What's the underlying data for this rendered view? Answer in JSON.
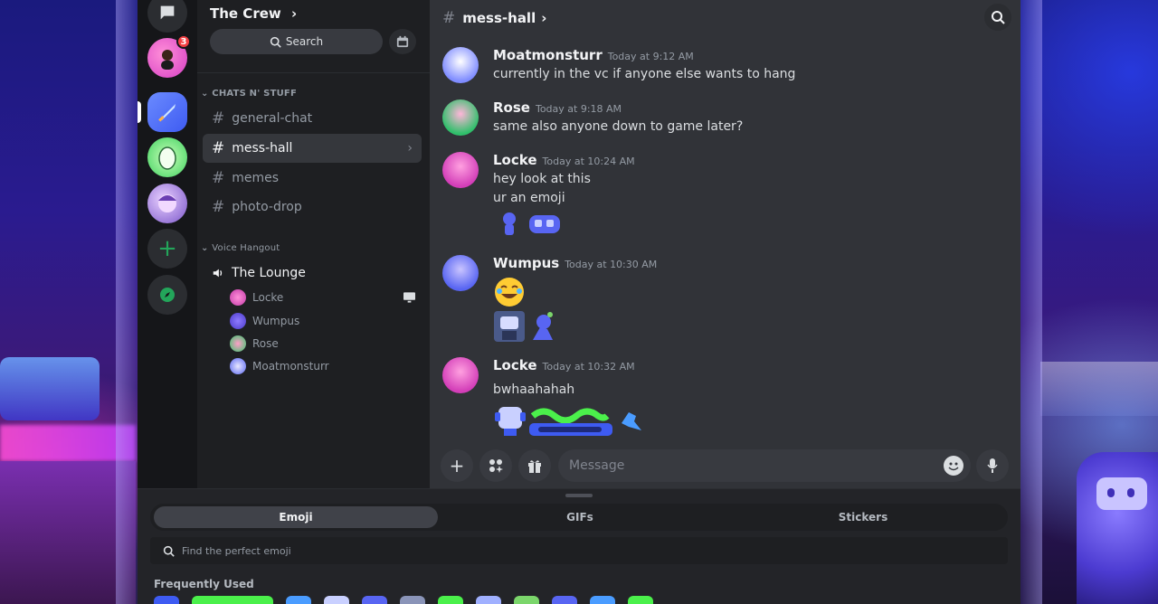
{
  "server": {
    "name": "The Crew",
    "search_label": "Search",
    "unread_badge": "3"
  },
  "categories": {
    "text": "CHATS N' STUFF",
    "voice": "Voice Hangout"
  },
  "text_channels": [
    {
      "name": "general-chat",
      "active": false
    },
    {
      "name": "mess-hall",
      "active": true
    },
    {
      "name": "memes",
      "active": false
    },
    {
      "name": "photo-drop",
      "active": false
    }
  ],
  "voice_channel": {
    "name": "The Lounge",
    "users": [
      "Locke",
      "Wumpus",
      "Rose",
      "Moatmonsturr"
    ]
  },
  "chat": {
    "channel": "mess-hall",
    "messages": [
      {
        "author": "Moatmonsturr",
        "time": "Today at 9:12 AM",
        "lines": [
          "currently in the vc if anyone else wants to hang"
        ]
      },
      {
        "author": "Rose",
        "time": "Today at 9:18 AM",
        "lines": [
          "same also anyone down to game later?"
        ]
      },
      {
        "author": "Locke",
        "time": "Today at 10:24 AM",
        "lines": [
          "hey look at this",
          "ur an emoji"
        ]
      },
      {
        "author": "Wumpus",
        "time": "Today at 10:30 AM",
        "lines": []
      },
      {
        "author": "Locke",
        "time": "Today at 10:32 AM",
        "lines": [
          "bwhaahahah"
        ]
      }
    ],
    "composer_placeholder": "Message"
  },
  "emoji_drawer": {
    "tabs": [
      "Emoji",
      "GIFs",
      "Stickers"
    ],
    "active_tab": "Emoji",
    "search_placeholder": "Find the perfect emoji",
    "section_title": "Frequently Used"
  },
  "colors": {
    "online_green": "#23a55a",
    "badge_red": "#f23f43",
    "blurple": "#5865f2"
  }
}
